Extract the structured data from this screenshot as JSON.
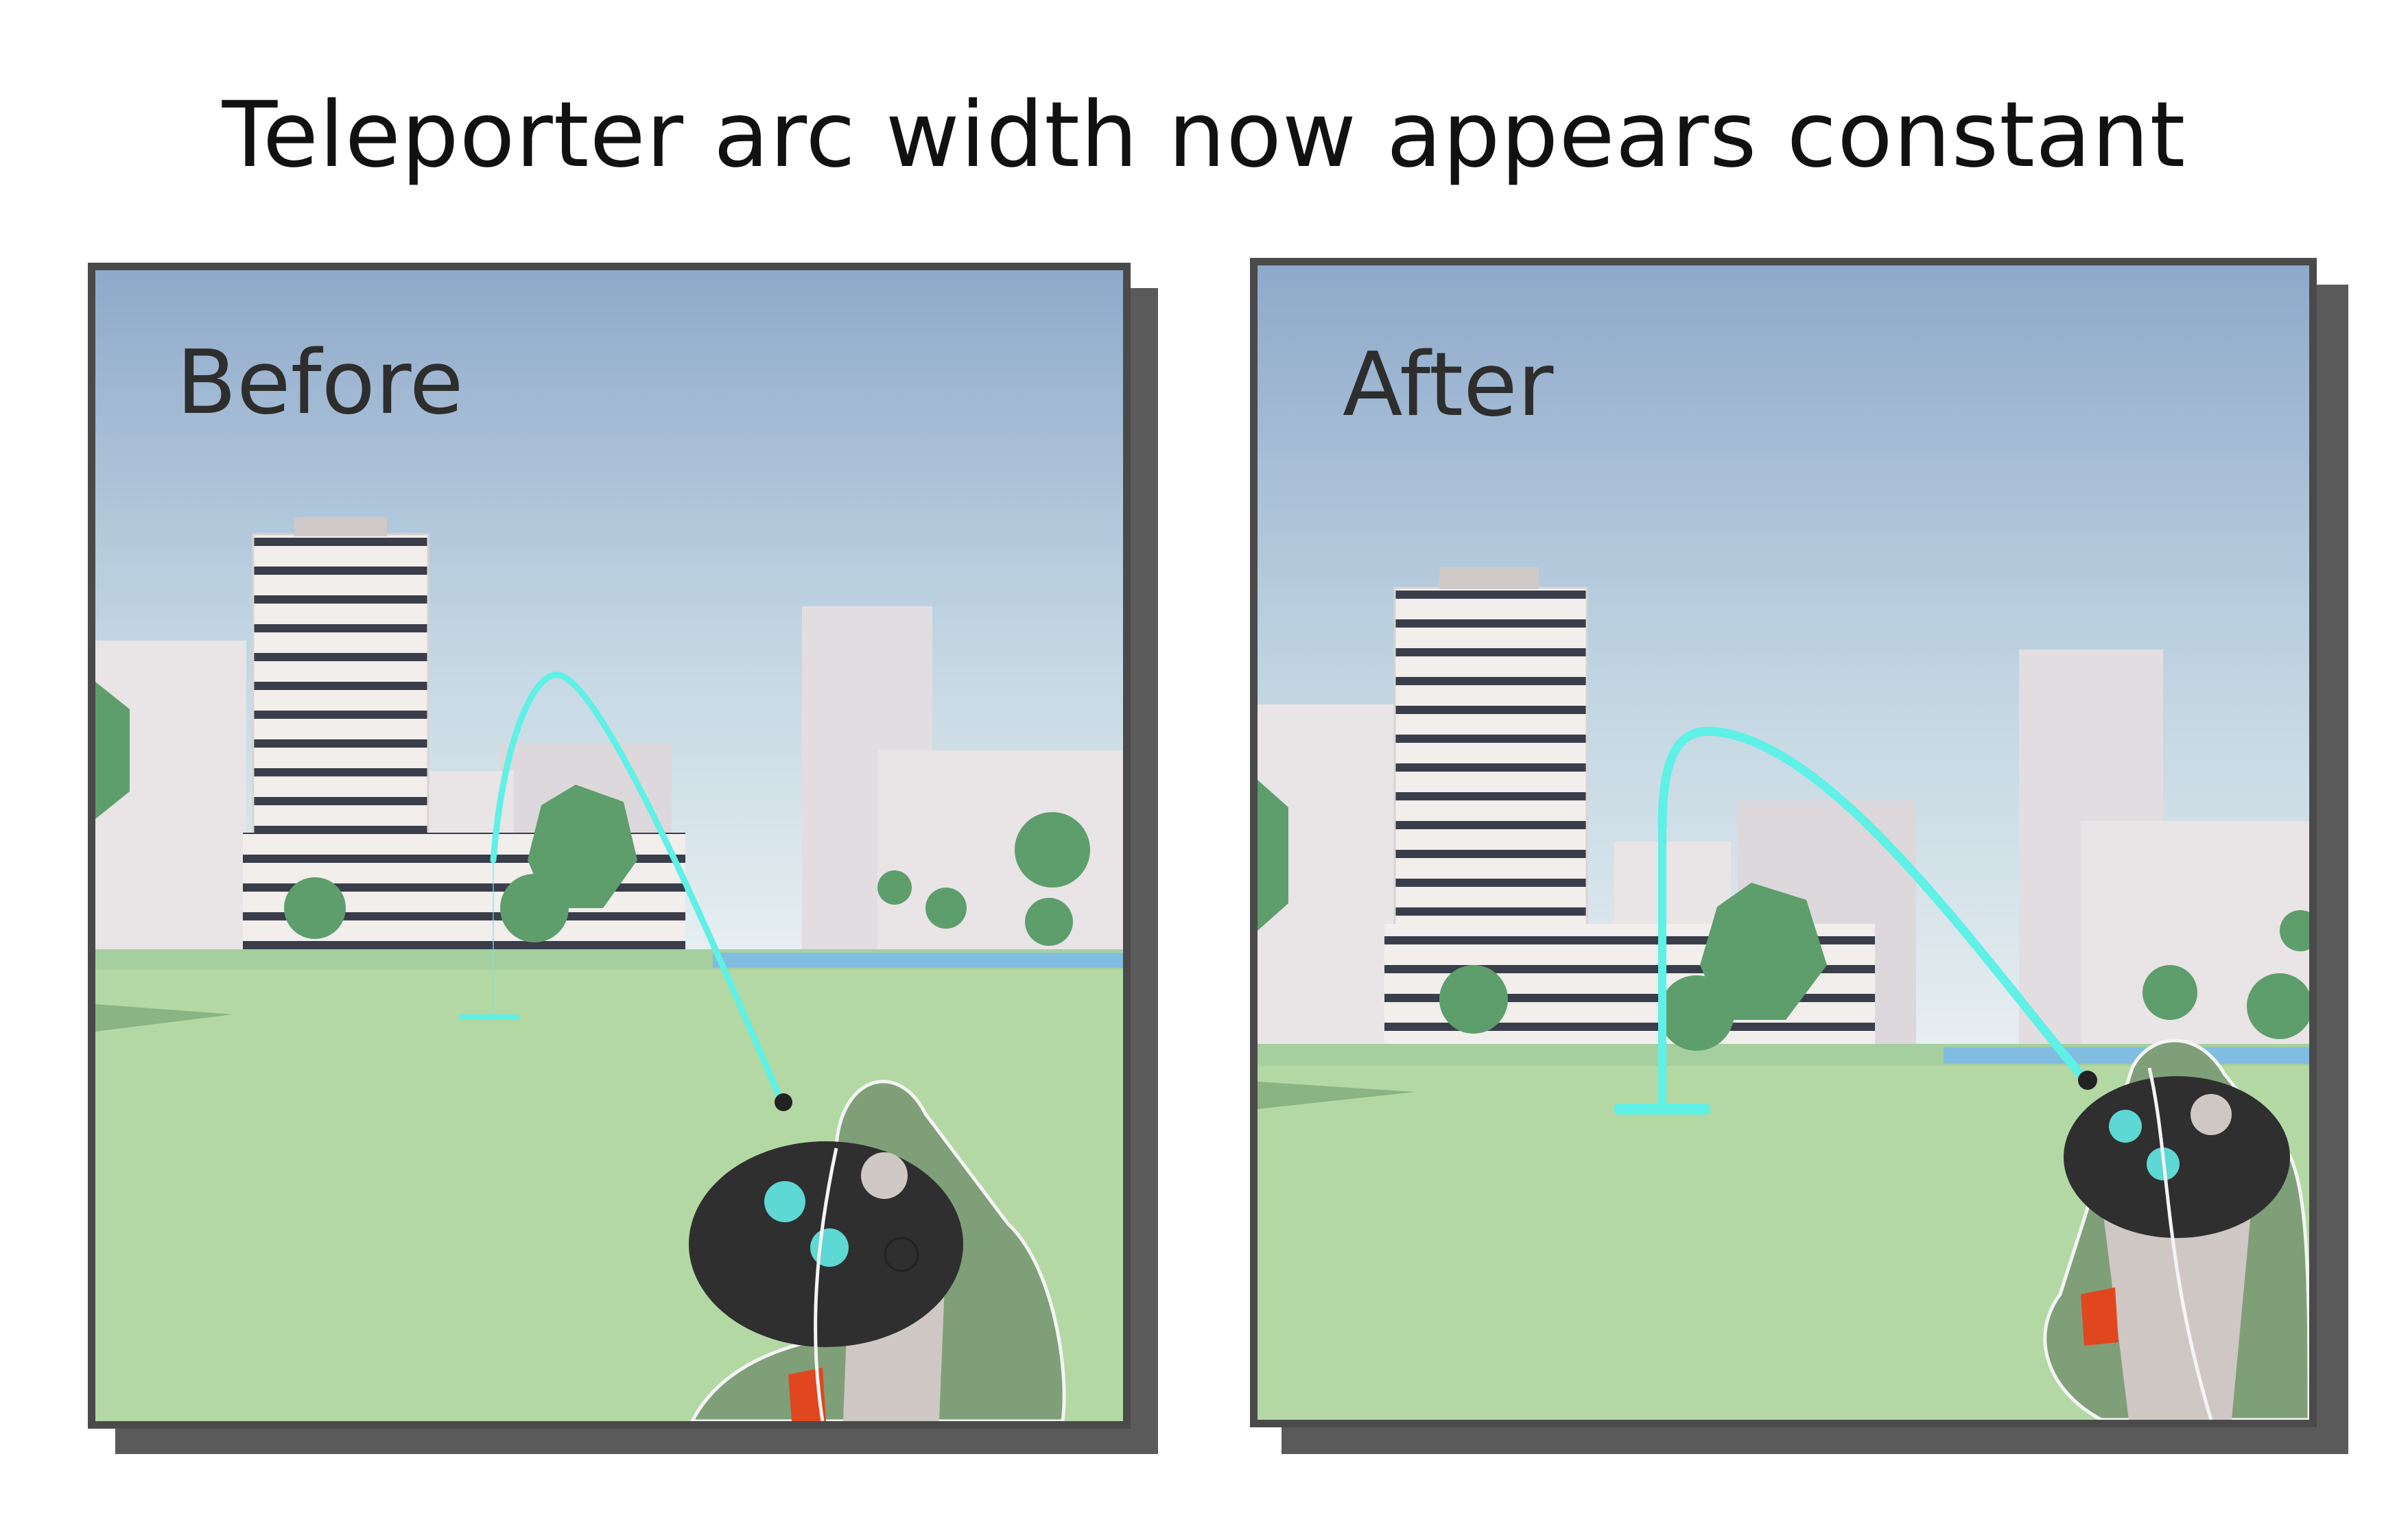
{
  "title": "Teleporter arc width now appears constant",
  "panels": {
    "before": {
      "label": "Before"
    },
    "after": {
      "label": "After"
    }
  },
  "colors": {
    "sky_top": "#8fa9cb",
    "sky_bottom": "#e3ecf0",
    "ground": "#b3d8a4",
    "arc": "#5ff0e6",
    "frame": "#4a4a4a",
    "frame_shadow": "#5a5a5a",
    "tree": "#5e9e6c",
    "controller": "#2e2e2e",
    "trigger": "#e0471f"
  }
}
